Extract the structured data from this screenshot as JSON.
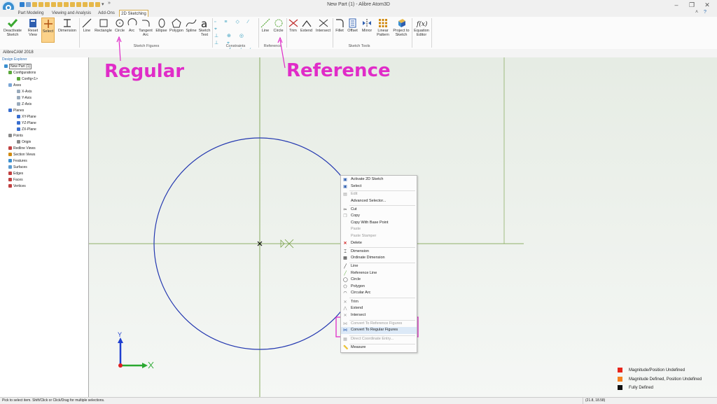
{
  "title_bar": {
    "window_title": "New Part (1) - Alibre Atom3D"
  },
  "tabs": [
    "Part Modeling",
    "Viewing and Analysis",
    "Add-Ons",
    "2D Sketching"
  ],
  "ribbon": {
    "buttons": {
      "deactivate_sketch": "Deactivate Sketch",
      "reset_view": "Reset View",
      "select": "Select",
      "dimension": "Dimension",
      "line": "Line",
      "rectangle": "Rectangle",
      "circle": "Circle",
      "arc": "Arc",
      "tangent_arc": "Tangent Arc",
      "ellipse": "Ellipse",
      "polygon": "Polygon",
      "spline": "Spline",
      "sketch_text": "Sketch Text",
      "ref_line": "Line",
      "ref_circle": "Circle",
      "trim": "Trim",
      "extend": "Extend",
      "intersect": "Intersect",
      "fillet": "Fillet",
      "offset": "Offset",
      "mirror": "Mirror",
      "linear_pattern": "Linear Pattern",
      "project_to_sketch": "Project to Sketch",
      "equation_editor": "Equation Editor"
    },
    "groups": {
      "sketch_figures": "Sketch Figures",
      "constraints": "Constraints",
      "reference": "Reference",
      "sketch_tools": "Sketch Tools"
    }
  },
  "alibrecam_label": "AlibreCAM 2018",
  "design_explorer": {
    "title": "Design Explorer",
    "tree": [
      "New Part (1)",
      "Configurations",
      "Config<1>",
      "Axes",
      "X-Axis",
      "Y-Axis",
      "Z-Axis",
      "Planes",
      "XY-Plane",
      "YZ-Plane",
      "ZX-Plane",
      "Points",
      "Origin",
      "Redline Views",
      "Section Views",
      "Features",
      "Surfaces",
      "Edges",
      "Faces",
      "Vertices"
    ]
  },
  "annotations": {
    "regular": "Regular",
    "reference": "Reference"
  },
  "context_menu": {
    "items": [
      "Activate 2D Sketch",
      "Select",
      "Edit",
      "Advanced Selector...",
      "Cut",
      "Copy",
      "Copy With Base Point",
      "Paste",
      "Paste Stamper",
      "Delete",
      "Dimension",
      "Ordinate Dimension",
      "Line",
      "Reference Line",
      "Circle",
      "Polygon",
      "Circular Arc",
      "Trim",
      "Extend",
      "Intersect",
      "Convert To Reference Figures",
      "Convert To Regular Figures",
      "Direct Coordinate Entry...",
      "Measure"
    ]
  },
  "legend": {
    "items": [
      {
        "label": "Magnitude/Position Undefined",
        "color": "#e8251b"
      },
      {
        "label": "Magnitude Defined, Position Undefined",
        "color": "#f5821f"
      },
      {
        "label": "Fully Defined",
        "color": "#111111"
      }
    ]
  },
  "status_bar": {
    "hint": "Pick to select item. Shift/Click or Click/Drag for multiple selections.",
    "coords": "(21.8, 18.58)"
  },
  "colors": {
    "annotation": "#e02cc8",
    "highlight_box": "#e02cc8",
    "circle": "#2438b0",
    "axis": "#6f9a3c"
  }
}
